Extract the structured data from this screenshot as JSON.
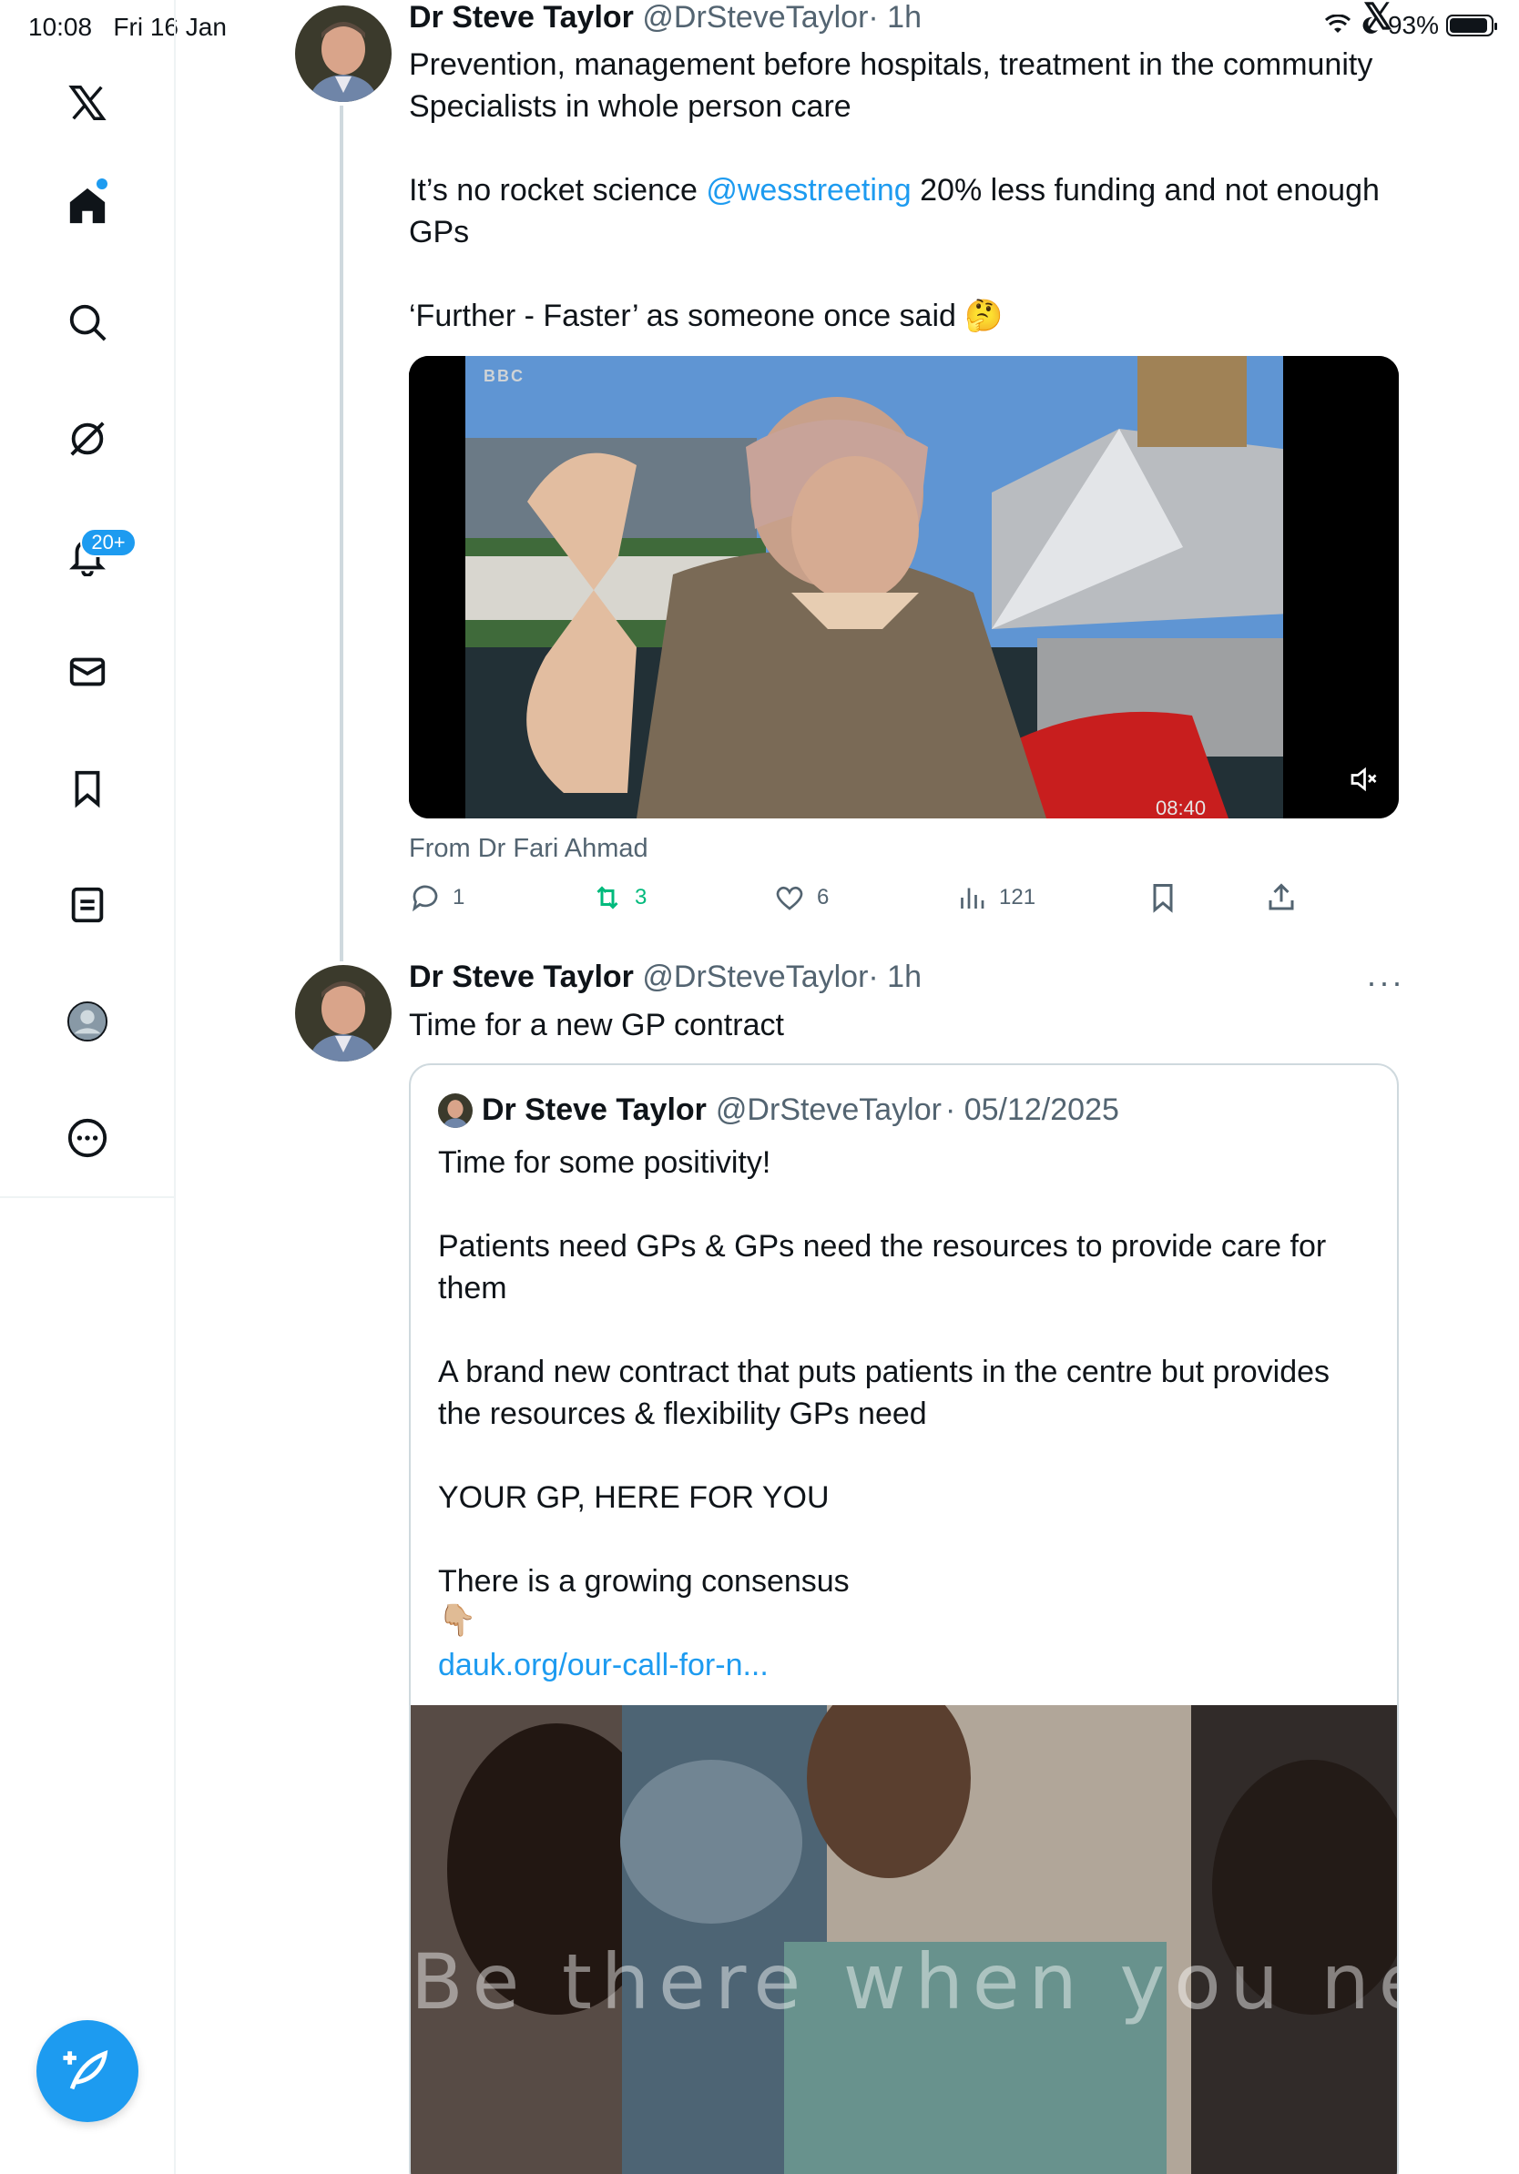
{
  "status_bar": {
    "time": "10:08",
    "date": "Fri 16 Jan",
    "battery": "93%",
    "battery_level": 0.93
  },
  "sidebar": {
    "items": [
      {
        "name": "x-logo",
        "icon": "x-logo-icon"
      },
      {
        "name": "home",
        "icon": "home-icon"
      },
      {
        "name": "search",
        "icon": "search-icon"
      },
      {
        "name": "grok",
        "icon": "grok-icon"
      },
      {
        "name": "notifications",
        "icon": "bell-icon",
        "badge": "20+"
      },
      {
        "name": "messages",
        "icon": "mail-icon"
      },
      {
        "name": "bookmarks",
        "icon": "bookmark-icon"
      },
      {
        "name": "lists",
        "icon": "list-icon"
      },
      {
        "name": "profile",
        "icon": "profile-icon"
      },
      {
        "name": "more",
        "icon": "more-circle-icon"
      }
    ],
    "compose": {
      "icon": "compose-feather-icon"
    }
  },
  "tweet1": {
    "name": "Dr Steve Taylor",
    "handle": "@DrSteveTaylor",
    "time": "· 1h",
    "lines": [
      "Prevention, management before hospitals, treatment in the community",
      "Specialists in whole person care",
      "",
      "It’s no rocket science ",
      "",
      "‘Further - Faster’ as someone once said 🤔"
    ],
    "mention": "@wesstreeting",
    "line3_tail": " 20% less funding and not enough GPs",
    "video": {
      "duration": "08:40",
      "channel_logo": "BBC",
      "muted": true
    },
    "from": "From Dr Fari Ahmad",
    "actions": {
      "replies": "1",
      "reposts": "3",
      "likes": "6",
      "views": "121"
    },
    "colors": {
      "repost_active": "#00ba7c"
    }
  },
  "tweet2": {
    "name": "Dr Steve Taylor",
    "handle": "@DrSteveTaylor",
    "time": "· 1h",
    "text": "Time for a new GP contract",
    "quote": {
      "name": "Dr Steve Taylor",
      "handle": "@DrSteveTaylor",
      "date": "· 05/12/2025",
      "lines": [
        "Time for some positivity!",
        "",
        "Patients need GPs & GPs need the resources to provide care for them",
        "",
        "A brand new contract that puts patients in the centre but provides the resources & flexibility GPs need",
        "",
        "YOUR GP, HERE FOR YOU",
        "",
        "There is a growing consensus",
        "👇🏼"
      ],
      "link": "dauk.org/our-call-for-n...",
      "video_overlay": "Be there when you need"
    }
  },
  "colors": {
    "accent": "#1d9bf0",
    "text_primary": "#0f1419",
    "text_secondary": "#536471",
    "border": "#cfd9de"
  }
}
